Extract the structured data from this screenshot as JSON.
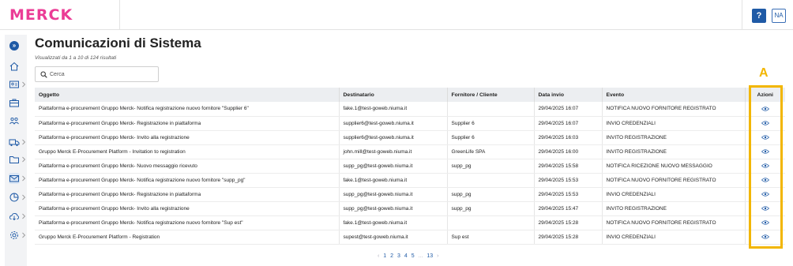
{
  "header": {
    "logo_text": "MERCK",
    "help_label": "?",
    "user_initials": "NA"
  },
  "sidebar": {
    "items": [
      {
        "icon": "expand-icon"
      },
      {
        "icon": "home-icon"
      },
      {
        "icon": "id-card-icon"
      },
      {
        "icon": "briefcase-icon"
      },
      {
        "icon": "users-icon"
      },
      {
        "icon": "truck-icon"
      },
      {
        "icon": "folder-icon"
      },
      {
        "icon": "mail-icon",
        "active": true
      },
      {
        "icon": "chart-icon"
      },
      {
        "icon": "cloud-download-icon"
      },
      {
        "icon": "settings-icon"
      }
    ]
  },
  "page": {
    "title": "Comunicazioni di Sistema",
    "results_info": "Visualizzati da 1 a 10 di 124 risultati",
    "search_placeholder": "Cerca"
  },
  "table": {
    "columns": [
      "Oggetto",
      "Destinatario",
      "Fornitore / Cliente",
      "Data invio",
      "Evento",
      "Azioni"
    ],
    "rows": [
      [
        "Piattaforma e-procurement Gruppo Merck- Notifica registrazione nuovo fornitore \"Supplier 6\"",
        "fake.1@test-goweb.niuma.it",
        "",
        "29/04/2025 16:07",
        "NOTIFICA NUOVO FORNITORE REGISTRATO"
      ],
      [
        "Piattaforma e-procurement Gruppo Merck- Registrazione in piattaforma",
        "supplier6@test-goweb.niuma.it",
        "Supplier 6",
        "29/04/2025 16:07",
        "INVIO CREDENZIALI"
      ],
      [
        "Piattaforma e-procurement Gruppo Merck- Invito alla registrazione",
        "supplier6@test-goweb.niuma.it",
        "Supplier 6",
        "29/04/2025 16:03",
        "INVITO REGISTRAZIONE"
      ],
      [
        "Gruppo Merck E-Procurement Platform - Invitation to registration",
        "john.mill@test-goweb.niuma.it",
        "GreenLife SPA",
        "29/04/2025 16:00",
        "INVITO REGISTRAZIONE"
      ],
      [
        "Piattaforma e-procurement Gruppo Merck- Nuovo messaggio ricevuto",
        "supp_pg@test-goweb.niuma.it",
        "supp_pg",
        "29/04/2025 15:58",
        "NOTIFICA RICEZIONE NUOVO MESSAGGIO"
      ],
      [
        "Piattaforma e-procurement Gruppo Merck- Notifica registrazione nuovo fornitore \"supp_pg\"",
        "fake.1@test-goweb.niuma.it",
        "",
        "29/04/2025 15:53",
        "NOTIFICA NUOVO FORNITORE REGISTRATO"
      ],
      [
        "Piattaforma e-procurement Gruppo Merck- Registrazione in piattaforma",
        "supp_pg@test-goweb.niuma.it",
        "supp_pg",
        "29/04/2025 15:53",
        "INVIO CREDENZIALI"
      ],
      [
        "Piattaforma e-procurement Gruppo Merck- Invito alla registrazione",
        "supp_pg@test-goweb.niuma.it",
        "supp_pg",
        "29/04/2025 15:47",
        "INVITO REGISTRAZIONE"
      ],
      [
        "Piattaforma e-procurement Gruppo Merck- Notifica registrazione nuovo fornitore \"Sup est\"",
        "fake.1@test-goweb.niuma.it",
        "",
        "29/04/2025 15:28",
        "NOTIFICA NUOVO FORNITORE REGISTRATO"
      ],
      [
        "Gruppo Merck E-Procurement Platform - Registration",
        "supest@test-goweb.niuma.it",
        "Sup est",
        "29/04/2025 15:28",
        "INVIO CREDENZIALI"
      ]
    ],
    "action_icon": "eye-icon"
  },
  "annotation": {
    "label": "A",
    "color": "#f2b600"
  },
  "pagination": {
    "prev": "‹",
    "pages": [
      "1",
      "2",
      "3",
      "4",
      "5"
    ],
    "ellipsis": "...",
    "last": "13",
    "next": "›"
  },
  "colors": {
    "brand": "#eb3c96",
    "accent": "#1f5aa6",
    "annotation": "#f2b600"
  }
}
